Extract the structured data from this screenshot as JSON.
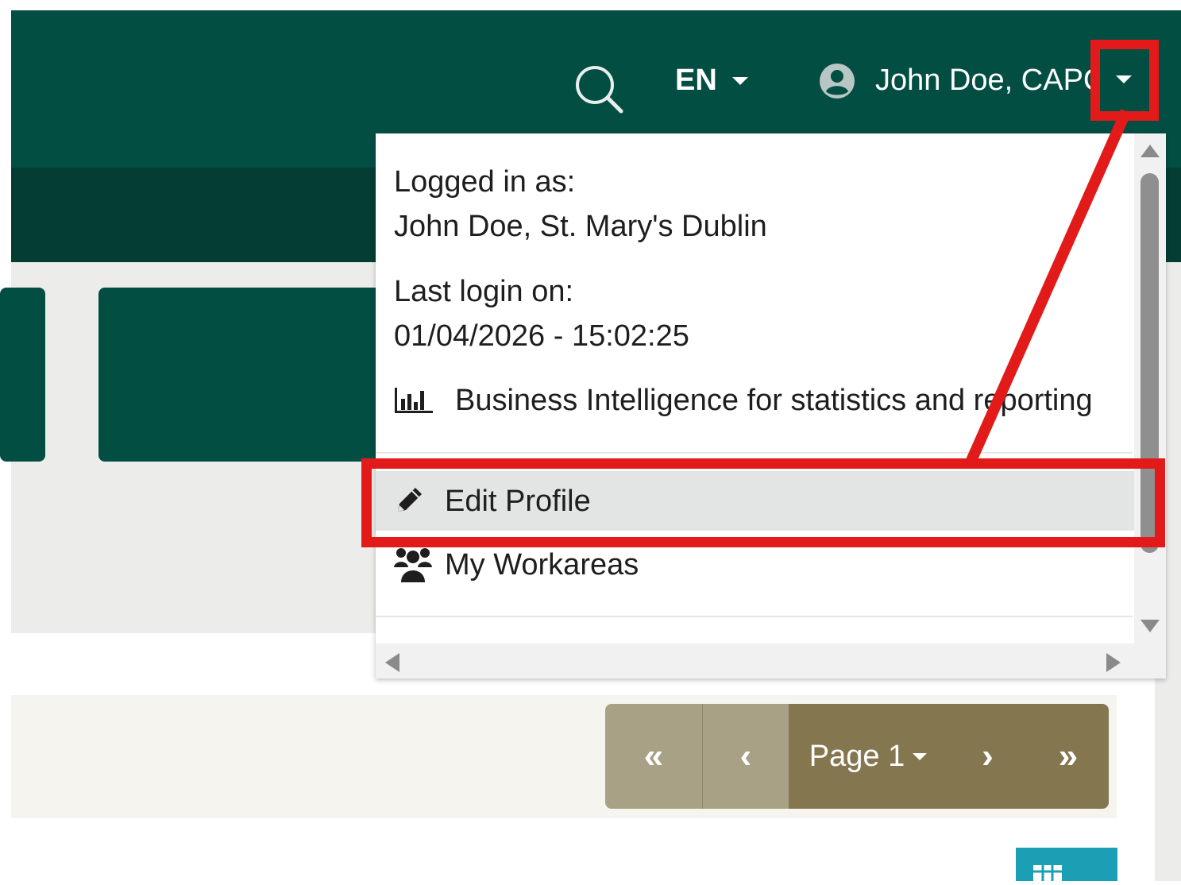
{
  "header": {
    "language": "EN",
    "user_name": "John Doe, CAPC"
  },
  "user_menu": {
    "logged_in_label": "Logged in as:",
    "logged_in_value": "John Doe, St. Mary's Dublin",
    "last_login_label": "Last login on:",
    "last_login_value": "01/04/2026 - 15:02:25",
    "bi_link": "Business Intelligence for statistics and reporting",
    "edit_profile": "Edit Profile",
    "my_workareas": "My Workareas"
  },
  "pagination": {
    "first": "«",
    "prev": "‹",
    "page_label": "Page 1",
    "next": "›",
    "last": "»"
  },
  "icons": {
    "search": "search-icon",
    "user": "user-circle-icon",
    "bi": "bar-chart-icon",
    "edit": "pencil-icon",
    "workareas": "users-icon",
    "grid": "grid-icon"
  },
  "colors": {
    "header_bg": "#034e43",
    "subheader_bg": "#043d34",
    "annotation": "#e31a1a",
    "pager_light": "#a9a185",
    "pager_dark": "#84764f",
    "accent_button": "#1b9fb5"
  }
}
